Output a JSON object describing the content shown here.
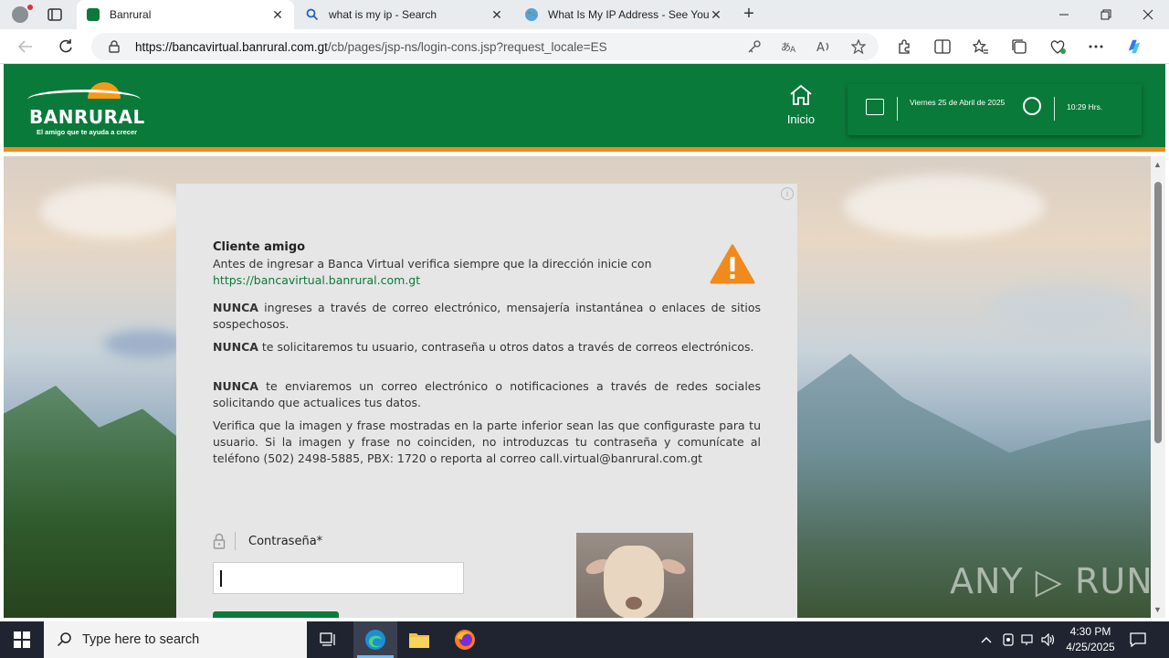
{
  "browser": {
    "tabs": [
      {
        "title": "Banrural",
        "active": true
      },
      {
        "title": "what is my ip - Search",
        "active": false
      },
      {
        "title": "What Is My IP Address - See Your",
        "active": false
      }
    ],
    "url_host": "https://bancavirtual.banrural.com.gt",
    "url_path": "/cb/pages/jsp-ns/login-cons.jsp?request_locale=ES",
    "close_glyph": "✕",
    "new_tab_glyph": "+"
  },
  "header": {
    "brand": "BANRURAL",
    "tagline": "El amigo que te ayuda a crecer",
    "home_label": "Inicio",
    "date": "Viernes 25 de Abril de 2025",
    "time": "10:29 Hrs.",
    "colors": {
      "brand_green": "#0a7a3a",
      "accent_orange": "#f08a1d"
    }
  },
  "notice": {
    "heading": "Cliente amigo",
    "intro": "Antes de ingresar a Banca Virtual verifica siempre que la dirección inicie con",
    "link": "https://bancavirtual.banrural.com.gt",
    "warnings": [
      {
        "lead": "NUNCA",
        "text": " ingreses a través de correo electrónico, mensajería instantánea o enlaces de sitios sospechosos."
      },
      {
        "lead": "NUNCA",
        "text": " te solicitaremos tu usuario, contraseña u otros datos a través de correos electrónicos."
      },
      {
        "lead": "NUNCA",
        "text": " te enviaremos un correo electrónico o notificaciones a través de redes sociales solicitando que actualices tus datos."
      }
    ],
    "verify": "Verifica que la imagen y frase mostradas en la parte inferior sean las que configuraste para tu usuario. Si la imagen y frase no coinciden, no introduzcas tu contraseña y comunícate al teléfono (502) 2498-5885, PBX: 1720 o reporta al correo call.virtual@banrural.com.gt"
  },
  "login": {
    "password_label": "Contraseña*",
    "password_value": ""
  },
  "watermark": "ANY ▷ RUN",
  "taskbar": {
    "search_placeholder": "Type here to search",
    "time": "4:30 PM",
    "date": "4/25/2025"
  }
}
